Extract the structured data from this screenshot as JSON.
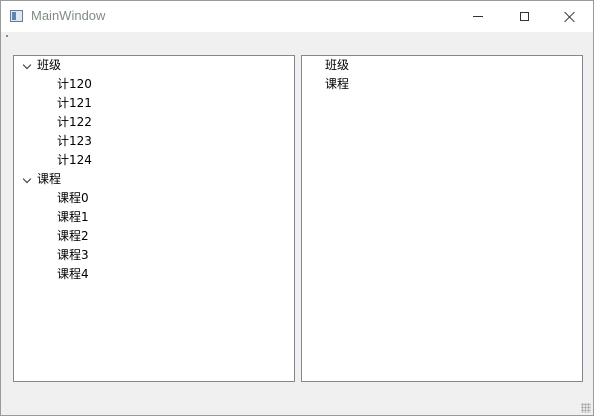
{
  "window": {
    "title": "MainWindow",
    "icons": {
      "app": "window-app-icon",
      "minimize": "minimize-icon",
      "maximize": "maximize-icon",
      "close": "close-icon"
    }
  },
  "left_tree": {
    "groups": [
      {
        "label": "班级",
        "expanded": true,
        "children": [
          "计120",
          "计121",
          "计122",
          "计123",
          "计124"
        ]
      },
      {
        "label": "课程",
        "expanded": true,
        "children": [
          "课程0",
          "课程1",
          "课程2",
          "课程3",
          "课程4"
        ]
      }
    ]
  },
  "right_list": {
    "items": [
      "班级",
      "课程"
    ]
  }
}
